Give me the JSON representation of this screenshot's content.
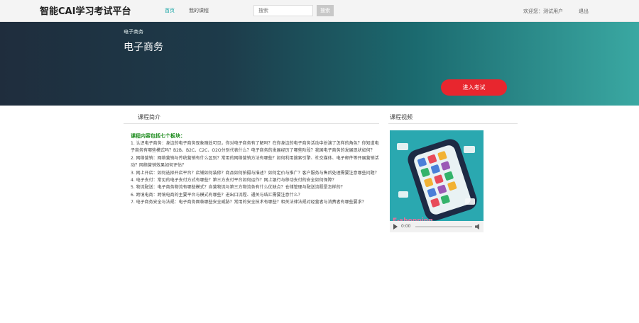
{
  "navbar": {
    "brand": "智能CAI学习考试平台",
    "home_label": "首页",
    "my_courses_label": "我的课程",
    "search_placeholder": "搜索",
    "search_button": "搜索",
    "welcome_text": "欢迎您：测试用户",
    "logout_label": "退出"
  },
  "banner": {
    "breadcrumb": "电子商务",
    "title": "电子商务",
    "enter_exam_button": "进入考试"
  },
  "intro": {
    "tab_label": "课程简介",
    "heading": "课程内容包括七个板块：",
    "items": [
      "1. 认识电子商务：身边的电子商务现象随处可见，你对电子商务有了解吗？在你身边的电子商务活动中扮演了怎样的角色？你知道电子商务有哪些模式吗？B2B、B2C、C2C、O2O分别代表什么？电子商务的发展经历了哪些阶段？我国电子商务的发展现状如何？",
      "2. 网络营销：网络营销与传统营销有什么区别？常用的网络营销方法有哪些？如何利用搜索引擎、社交媒体、电子邮件等开展营销活动？网络营销效果如何评估？",
      "3. 网上开店：如何选择开店平台？店铺如何装修？商品如何拍摄与描述？如何定价与推广？客户服务与售后处理需要注意哪些问题？",
      "4. 电子支付：常见的电子支付方式有哪些？第三方支付平台如何运作？网上银行与移动支付的安全如何保障？",
      "5. 物流配送：电子商务物流有哪些模式？自营物流与第三方物流各有什么优缺点？仓储管理与配送流程是怎样的？",
      "6. 跨境电商：跨境电商的主要平台与模式有哪些？进出口流程、通关与结汇需要注意什么？",
      "7. 电子商务安全与法规：电子商务面临哪些安全威胁？常用的安全技术有哪些？相关法律法规对经营者与消费者有哪些要求？"
    ]
  },
  "video": {
    "tab_label": "课程视频",
    "caption": "E-shopping",
    "time": "0:00"
  }
}
